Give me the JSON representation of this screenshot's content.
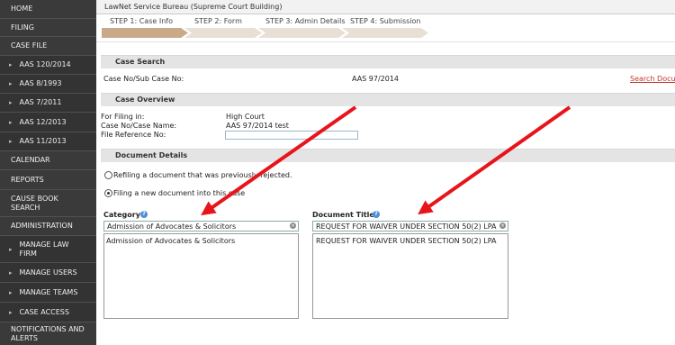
{
  "sidebar": {
    "items": [
      {
        "label": "HOME",
        "sub": false
      },
      {
        "label": "FILING",
        "sub": false
      },
      {
        "label": "CASE FILE",
        "sub": false
      },
      {
        "label": "AAS 120/2014",
        "sub": true
      },
      {
        "label": "AAS 8/1993",
        "sub": true
      },
      {
        "label": "AAS 7/2011",
        "sub": true
      },
      {
        "label": "AAS 12/2013",
        "sub": true
      },
      {
        "label": "AAS 11/2013",
        "sub": true
      },
      {
        "label": "CALENDAR",
        "sub": false
      },
      {
        "label": "REPORTS",
        "sub": false
      },
      {
        "label": "CAUSE BOOK SEARCH",
        "sub": false
      },
      {
        "label": "ADMINISTRATION",
        "sub": false
      },
      {
        "label": "MANAGE LAW FIRM",
        "sub": true
      },
      {
        "label": "MANAGE USERS",
        "sub": true
      },
      {
        "label": "MANAGE TEAMS",
        "sub": true
      },
      {
        "label": "CASE ACCESS",
        "sub": true
      },
      {
        "label": "NOTIFICATIONS AND ALERTS",
        "sub": false
      }
    ]
  },
  "header": {
    "title": "LawNet Service Bureau (Supreme Court Building)"
  },
  "steps": [
    {
      "label": "STEP 1: Case Info",
      "active": true
    },
    {
      "label": "STEP 2: Form",
      "active": false
    },
    {
      "label": "STEP 3: Admin Details",
      "active": false
    },
    {
      "label": "STEP 4: Submission",
      "active": false
    }
  ],
  "case_search": {
    "heading": "Case Search",
    "label": "Case No/Sub Case No:",
    "value": "AAS 97/2014",
    "link": "Search Docum"
  },
  "case_overview": {
    "heading": "Case Overview",
    "filing_in_label": "For Filing in:",
    "filing_in_value": "High Court",
    "case_name_label": "Case No/Case Name:",
    "case_name_value": "AAS 97/2014 test",
    "file_ref_label": "File Reference No:",
    "file_ref_value": ""
  },
  "document_details": {
    "heading": "Document Details",
    "option_refile": "Refiling a document that was previously rejected.",
    "option_new": "Filing a new document into this case",
    "selected_option": "new",
    "category_label": "Category",
    "category_value": "Admission of Advocates & Solicitors",
    "category_options": [
      "Admission of Advocates & Solicitors"
    ],
    "doc_title_label": "Document Title",
    "doc_title_value": "REQUEST FOR WAIVER UNDER SECTION 50(2) LPA",
    "doc_title_options": [
      "REQUEST FOR WAIVER UNDER SECTION 50(2) LPA"
    ]
  },
  "colors": {
    "sidebar_bg": "#3a3a3a",
    "step_active": "#c9a989",
    "step_inactive": "#e8e0d6",
    "annotation_arrow": "#e8141b",
    "link": "#c0392b"
  },
  "icons": [
    "help-icon",
    "clear-icon",
    "arrow-icon",
    "radio-icon"
  ]
}
